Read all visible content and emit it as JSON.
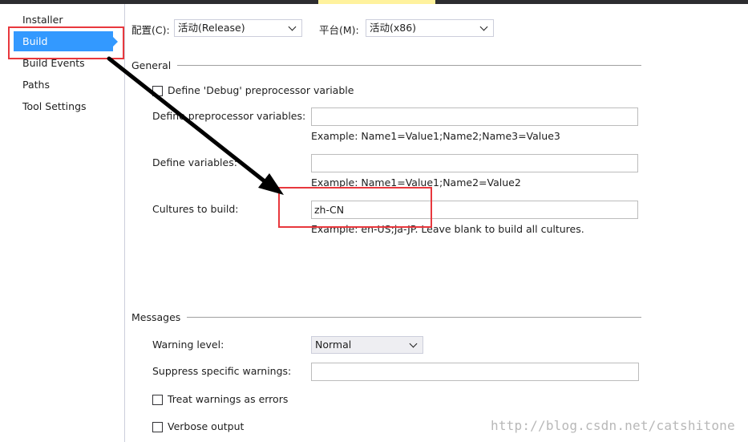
{
  "sidebar": {
    "items": [
      {
        "label": "Installer"
      },
      {
        "label": "Build"
      },
      {
        "label": "Build Events"
      },
      {
        "label": "Paths"
      },
      {
        "label": "Tool Settings"
      }
    ]
  },
  "config_bar": {
    "configuration_label": "配置(C):",
    "configuration_value": "活动(Release)",
    "platform_label": "平台(M):",
    "platform_value": "活动(x86)"
  },
  "general": {
    "title": "General",
    "define_debug_label": "Define 'Debug' preprocessor variable",
    "define_debug_checked": false,
    "preprocessor_vars_label": "Define preprocessor variables:",
    "preprocessor_vars_value": "",
    "preprocessor_vars_hint": "Example: Name1=Value1;Name2;Name3=Value3",
    "define_vars_label": "Define variables:",
    "define_vars_value": "",
    "define_vars_hint": "Example: Name1=Value1;Name2=Value2",
    "cultures_label": "Cultures to build:",
    "cultures_value": "zh-CN",
    "cultures_hint": "Example: en-US;ja-JP. Leave blank to build all cultures."
  },
  "messages": {
    "title": "Messages",
    "warning_level_label": "Warning level:",
    "warning_level_value": "Normal",
    "suppress_label": "Suppress specific warnings:",
    "suppress_value": "",
    "treat_errors_label": "Treat warnings as errors",
    "treat_errors_checked": false,
    "verbose_label": "Verbose output",
    "verbose_checked": false
  },
  "watermark": "http://blog.csdn.net/catshitone",
  "colors": {
    "selection": "#3399ff",
    "annotation": "#e8383d",
    "arrow": "#000000"
  }
}
